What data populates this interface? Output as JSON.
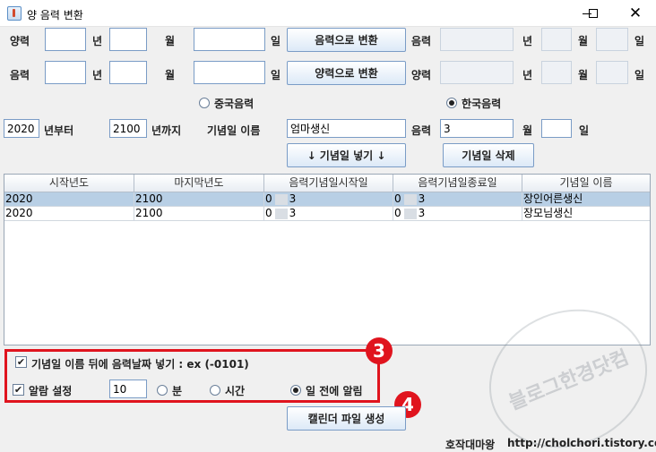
{
  "window": {
    "title": "양 음력 변환",
    "controls": {
      "minimize": "—",
      "maximize": "☐",
      "close": "✕"
    }
  },
  "row1": {
    "label_year": "양력",
    "unit_year": "년",
    "unit_month": "월",
    "unit_day": "일",
    "convert_button": "음력으로 변환",
    "result_label": "음력",
    "result_unit_year": "년",
    "result_unit_month": "월",
    "result_unit_day": "일"
  },
  "row2": {
    "label_year": "음력",
    "unit_year": "년",
    "unit_month": "월",
    "unit_day": "일",
    "convert_button": "양력으로 변환",
    "result_label": "양력",
    "result_unit_year": "년",
    "result_unit_month": "월",
    "result_unit_day": "일"
  },
  "calendar_type": {
    "options": [
      "중국음력",
      "한국음력"
    ],
    "selected": "한국음력"
  },
  "anniversary": {
    "from_year": "2020",
    "from_label": "년부터",
    "to_year": "2100",
    "to_label": "년까지",
    "name_label": "기념일 이름",
    "name_value": "엄마생신",
    "lunar_label": "음력",
    "month_value": "3",
    "month_unit": "월",
    "day_value": "",
    "day_unit": "일",
    "add_button": "↓ 기념일 넣기 ↓",
    "delete_button": "기념일 삭제"
  },
  "table": {
    "columns": [
      "시작년도",
      "마지막년도",
      "음력기념일시작일",
      "음력기념일종료일",
      "기념일 이름"
    ],
    "rows": [
      {
        "start_year": "2020",
        "end_year": "2100",
        "start_m": "0",
        "start_d": "3",
        "end_m": "0",
        "end_d": "3",
        "name": "장인어른생신"
      },
      {
        "start_year": "2020",
        "end_year": "2100",
        "start_m": "0",
        "start_d": "3",
        "end_m": "0",
        "end_d": "3",
        "name": "장모님생신"
      }
    ],
    "selected_row": 0
  },
  "options": {
    "append_date_label": "기념일 이름 뒤에 음력날짜 넣기 : ex (-0101)",
    "append_date_checked": true,
    "alarm_label": "알람 설정",
    "alarm_checked": true,
    "alarm_value": "10",
    "unit_options": [
      "분",
      "시간",
      "일 전에 알림"
    ],
    "unit_selected": "일 전에 알림"
  },
  "generate_button": "캘린더 파일 생성",
  "badges": [
    "3",
    "4"
  ],
  "footer": {
    "author": "호작대마왕",
    "url": "http://cholchori.tistory.com"
  },
  "watermark": "블로그한경닷컴",
  "colors": {
    "annotation_red": "#e0141e",
    "selected_row": "#b8cfe5",
    "button_border": "#7a9cc6"
  }
}
